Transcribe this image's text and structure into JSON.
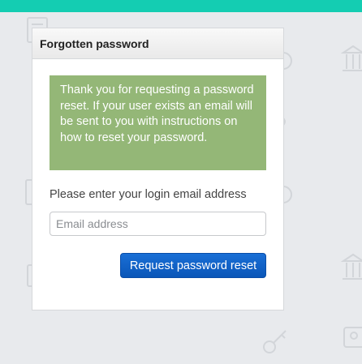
{
  "panel": {
    "title": "Forgotten password",
    "notice": "Thank you for requesting a password reset. If your user exists an email will be sent to you with instructions on how to reset your password.",
    "prompt": "Please enter your login email address",
    "email_input": {
      "value": "",
      "placeholder": "Email address"
    },
    "submit_label": "Request password reset"
  },
  "colors": {
    "top_bar": "#14cdb2",
    "notice_bg": "#94b777",
    "button": "#1a6fd6",
    "background": "#e8eaed"
  }
}
